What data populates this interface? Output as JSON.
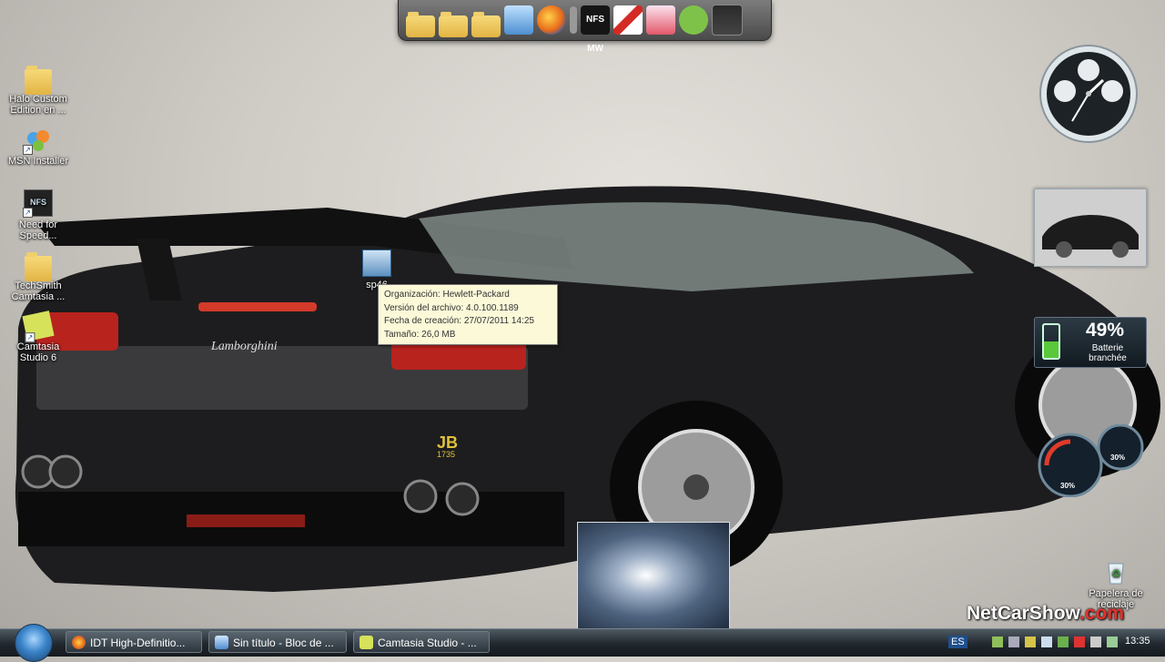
{
  "desktop": {
    "icons": [
      {
        "label": "Halo Custom Edition en ..."
      },
      {
        "label": "MSN Installer"
      },
      {
        "label": "Need for Speed..."
      },
      {
        "label": "TechSmith Camtasia ..."
      },
      {
        "label": "Camtasia Studio 6"
      },
      {
        "label": "sp46"
      }
    ],
    "recycle_bin": {
      "label": "Papelera de reciclaje"
    }
  },
  "dock": {
    "items": [
      {
        "icon": "folder-icon"
      },
      {
        "icon": "folder-icon"
      },
      {
        "icon": "folder-icon"
      },
      {
        "icon": "computer-icon"
      },
      {
        "icon": "firefox-icon"
      },
      {
        "icon": "separator"
      },
      {
        "icon": "nfs-mw-icon",
        "text": "NFS MW"
      },
      {
        "icon": "nfs-red-icon"
      },
      {
        "icon": "game-icon"
      },
      {
        "icon": "green-creature-icon"
      },
      {
        "icon": "nfs-shift-icon"
      }
    ]
  },
  "tooltip": {
    "line1": "Organización: Hewlett-Packard",
    "line2": "Versión del archivo: 4.0.100.1189",
    "line3": "Fecha de creación: 27/07/2011 14:25",
    "line4": "Tamaño: 26,0 MB"
  },
  "gadgets": {
    "battery": {
      "percent": "49%",
      "status": "Batterie branchée",
      "level": 0.49
    },
    "meter": {
      "cpu": "30%",
      "ram": "30%"
    }
  },
  "watermark": {
    "text_a": "NetCarShow",
    "text_b": ".com"
  },
  "taskbar": {
    "tasks": [
      {
        "label": "IDT High-Definitio..."
      },
      {
        "label": "Sin título - Bloc de ..."
      },
      {
        "label": "Camtasia Studio - ..."
      }
    ],
    "language": "ES",
    "clock": "13:35"
  },
  "colors": {
    "battery_green": "#5ac83a",
    "accent_red": "#e5302a",
    "taskbar": "#20272d"
  }
}
